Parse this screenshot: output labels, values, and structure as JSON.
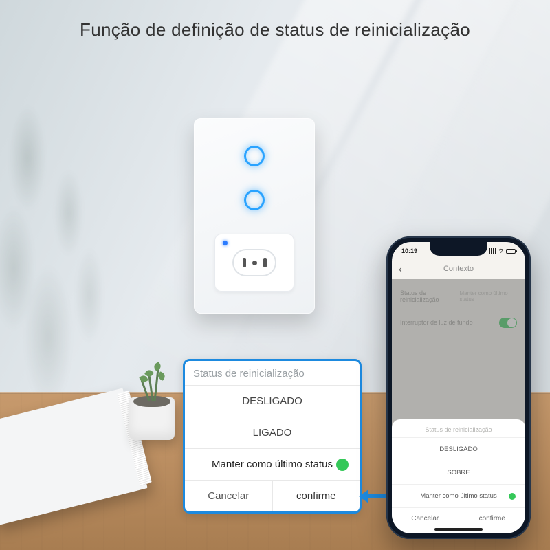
{
  "title": "Função de definição de status de reinicialização",
  "callout": {
    "header": "Status de reinicialização",
    "options": [
      "DESLIGADO",
      "LIGADO",
      "Manter como último status"
    ],
    "selected_index": 2,
    "cancel": "Cancelar",
    "confirm": "confirme"
  },
  "phone": {
    "time": "10:19",
    "nav_title": "Contexto",
    "setting_row1_label": "Status de reinicialização",
    "setting_row1_value": "Manter como último status",
    "setting_row2_label": "Interruptor de luz de fundo",
    "sheet": {
      "header": "Status de reinicialização",
      "options": [
        "DESLIGADO",
        "SOBRE",
        "Manter como último status"
      ],
      "selected_index": 2,
      "cancel": "Cancelar",
      "confirm": "confirme"
    }
  }
}
